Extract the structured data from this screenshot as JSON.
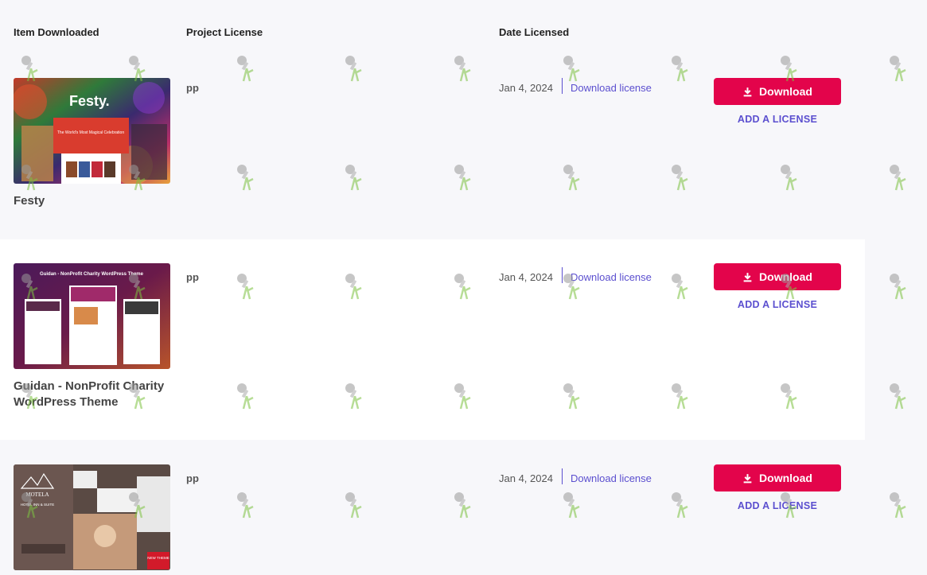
{
  "header": {
    "col_item": "Item Downloaded",
    "col_project": "Project License",
    "col_date": "Date Licensed"
  },
  "rows": [
    {
      "name": "Festy",
      "project": "pp",
      "date": "Jan 4, 2024",
      "license_link": "Download license",
      "download_label": "Download",
      "add_license_label": "ADD A LICENSE",
      "thumb_title": "Festy.",
      "thumb_caption": "The World's Most Magical Celebration"
    },
    {
      "name": "Guidan - NonProfit Charity WordPress Theme",
      "project": "pp",
      "date": "Jan 4, 2024",
      "license_link": "Download license",
      "download_label": "Download",
      "add_license_label": "ADD A LICENSE",
      "thumb_title": "Guidan - NonProfit Charity WordPress Theme"
    },
    {
      "name": "",
      "project": "pp",
      "date": "Jan 4, 2024",
      "license_link": "Download license",
      "download_label": "Download",
      "add_license_label": "ADD A LICENSE",
      "thumb_title": "MOTELA",
      "thumb_caption": "HOTEL INN & SUITE",
      "thumb_badge": "NEW THEME"
    }
  ],
  "colors": {
    "accent_button": "#e3044b",
    "link": "#5b4fcf"
  }
}
